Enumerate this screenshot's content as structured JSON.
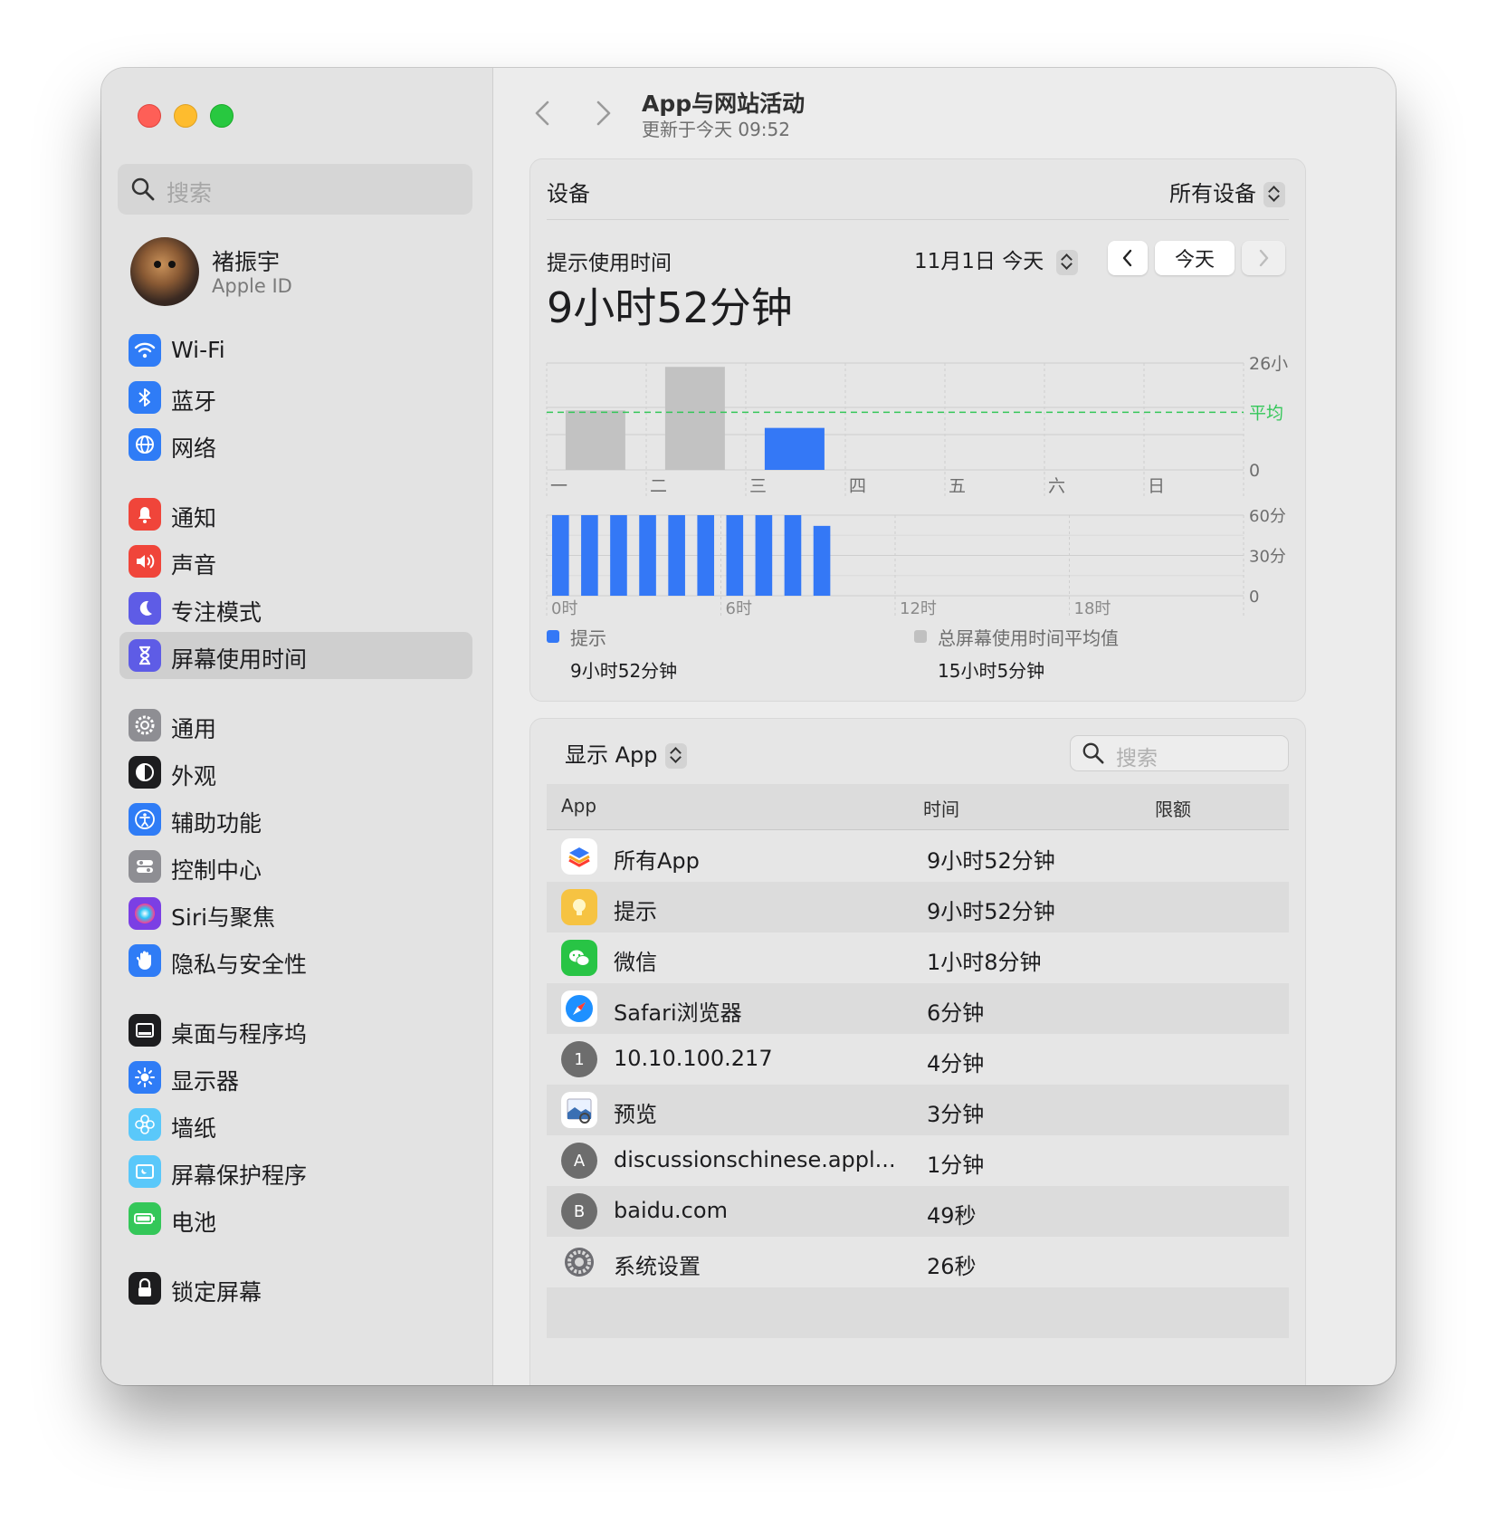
{
  "sidebar": {
    "search_placeholder": "搜索",
    "profile": {
      "name": "褚振宇",
      "subtitle": "Apple ID"
    },
    "items": [
      {
        "label": "Wi-Fi",
        "icon": "wifi-icon",
        "color": "#2f7cf6"
      },
      {
        "label": "蓝牙",
        "icon": "bluetooth-icon",
        "color": "#2f7cf6"
      },
      {
        "label": "网络",
        "icon": "globe-icon",
        "color": "#2f7cf6"
      },
      {
        "label": "通知",
        "icon": "bell-icon",
        "color": "#f0453a"
      },
      {
        "label": "声音",
        "icon": "speaker-icon",
        "color": "#f0453a"
      },
      {
        "label": "专注模式",
        "icon": "moon-icon",
        "color": "#5e5ce6"
      },
      {
        "label": "屏幕使用时间",
        "icon": "hourglass-icon",
        "color": "#5e5ce6",
        "selected": true
      },
      {
        "label": "通用",
        "icon": "gear-icon",
        "color": "#8e8e93"
      },
      {
        "label": "外观",
        "icon": "appearance-icon",
        "color": "#1d1d1f"
      },
      {
        "label": "辅助功能",
        "icon": "accessibility-icon",
        "color": "#2f7cf6"
      },
      {
        "label": "控制中心",
        "icon": "control-center-icon",
        "color": "#8e8e93"
      },
      {
        "label": "Siri与聚焦",
        "icon": "siri-icon",
        "color": "#7b3fe4"
      },
      {
        "label": "隐私与安全性",
        "icon": "hand-icon",
        "color": "#2f7cf6"
      },
      {
        "label": "桌面与程序坞",
        "icon": "dock-icon",
        "color": "#1d1d1f"
      },
      {
        "label": "显示器",
        "icon": "sun-icon",
        "color": "#2f7cf6"
      },
      {
        "label": "墙纸",
        "icon": "flower-icon",
        "color": "#5ac8fa"
      },
      {
        "label": "屏幕保护程序",
        "icon": "screensaver-icon",
        "color": "#5ac8fa"
      },
      {
        "label": "电池",
        "icon": "battery-icon",
        "color": "#34c759"
      },
      {
        "label": "锁定屏幕",
        "icon": "lock-icon",
        "color": "#1d1d1f"
      }
    ]
  },
  "header": {
    "title": "App与网站活动",
    "subtitle": "更新于今天 09:52"
  },
  "devices": {
    "label": "设备",
    "selected": "所有设备"
  },
  "usage": {
    "label": "提示使用时间",
    "total": "9小时52分钟",
    "date_selector": "11月1日 今天",
    "today_button": "今天"
  },
  "chart_data": [
    {
      "type": "bar",
      "categories": [
        "一",
        "二",
        "三",
        "四",
        "五",
        "六",
        "日"
      ],
      "values": [
        15.6,
        27.0,
        11.0,
        0,
        0,
        0,
        0
      ],
      "highlight_index": 2,
      "average": 15.1,
      "average_label": "平均",
      "ytick_labels": [
        "26小",
        "0"
      ],
      "ylim": [
        0,
        28
      ]
    },
    {
      "type": "bar",
      "x_tick_labels": [
        "0时",
        "6时",
        "12时",
        "18时"
      ],
      "values": [
        60,
        60,
        60,
        60,
        60,
        60,
        60,
        60,
        60,
        52,
        0,
        0,
        0,
        0,
        0,
        0,
        0,
        0,
        0,
        0,
        0,
        0,
        0,
        0
      ],
      "ytick_labels": [
        "60分",
        "30分",
        "0"
      ],
      "ylim": [
        0,
        60
      ]
    }
  ],
  "legend": [
    {
      "label": "提示",
      "value": "9小时52分钟",
      "color": "#3478f6"
    },
    {
      "label": "总屏幕使用时间平均值",
      "value": "15小时5分钟",
      "color": "#c0c0c0"
    }
  ],
  "apps_panel": {
    "show_select": "显示 App",
    "search_placeholder": "搜索",
    "columns": [
      "App",
      "时间",
      "限额"
    ],
    "rows": [
      {
        "name": "所有App",
        "time": "9小时52分钟",
        "icon": "stack-icon"
      },
      {
        "name": "提示",
        "time": "9小时52分钟",
        "icon": "tips-icon"
      },
      {
        "name": "微信",
        "time": "1小时8分钟",
        "icon": "wechat-icon"
      },
      {
        "name": "Safari浏览器",
        "time": "6分钟",
        "icon": "safari-icon"
      },
      {
        "name": "10.10.100.217",
        "time": "4分钟",
        "icon": "letter",
        "letter": "1"
      },
      {
        "name": "预览",
        "time": "3分钟",
        "icon": "preview-icon"
      },
      {
        "name": "discussionschinese.appl...",
        "time": "1分钟",
        "icon": "letter",
        "letter": "A"
      },
      {
        "name": "baidu.com",
        "time": "49秒",
        "icon": "letter",
        "letter": "B"
      },
      {
        "name": "系统设置",
        "time": "26秒",
        "icon": "settings-icon"
      }
    ]
  }
}
